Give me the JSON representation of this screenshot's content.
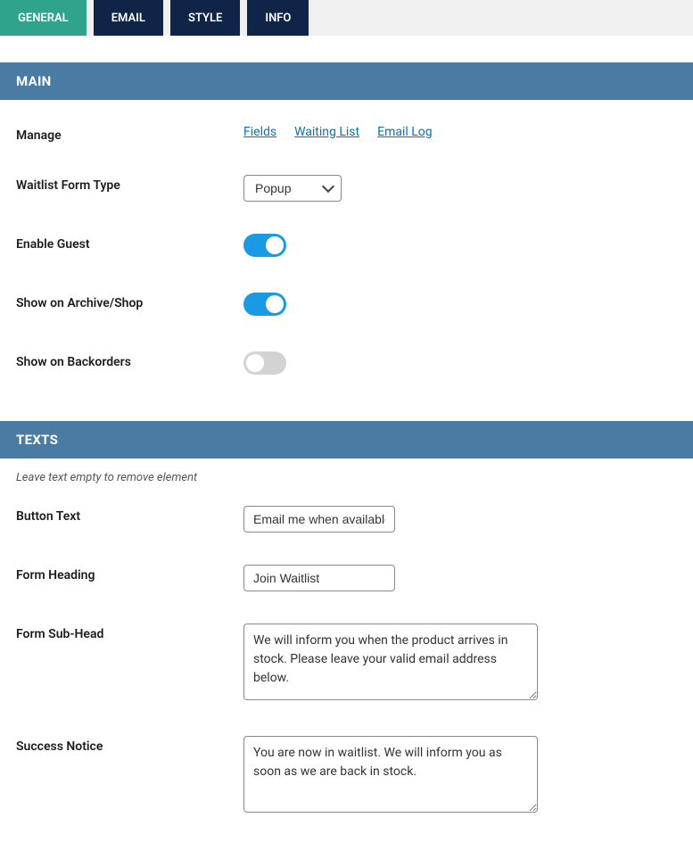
{
  "tabs": {
    "general": "GENERAL",
    "email": "EMAIL",
    "style": "STYLE",
    "info": "INFO"
  },
  "panels": {
    "main": {
      "title": "MAIN",
      "manage": {
        "label": "Manage",
        "links": {
          "fields": "Fields",
          "waiting_list": "Waiting List",
          "email_log": "Email Log"
        }
      },
      "form_type": {
        "label": "Waitlist Form Type",
        "value": "Popup"
      },
      "enable_guest": {
        "label": "Enable Guest",
        "value": true
      },
      "show_archive": {
        "label": "Show on Archive/Shop",
        "value": true
      },
      "show_backorders": {
        "label": "Show on Backorders",
        "value": false
      }
    },
    "texts": {
      "title": "TEXTS",
      "note": "Leave text empty to remove element",
      "button_text": {
        "label": "Button Text",
        "value": "Email me when available"
      },
      "form_heading": {
        "label": "Form Heading",
        "value": "Join Waitlist"
      },
      "form_subhead": {
        "label": "Form Sub-Head",
        "value": "We will inform you when the product arrives in stock. Please leave your valid email address below."
      },
      "success_notice": {
        "label": "Success Notice",
        "value": "You are now in waitlist. We will inform you as soon as we are back in stock."
      }
    }
  }
}
